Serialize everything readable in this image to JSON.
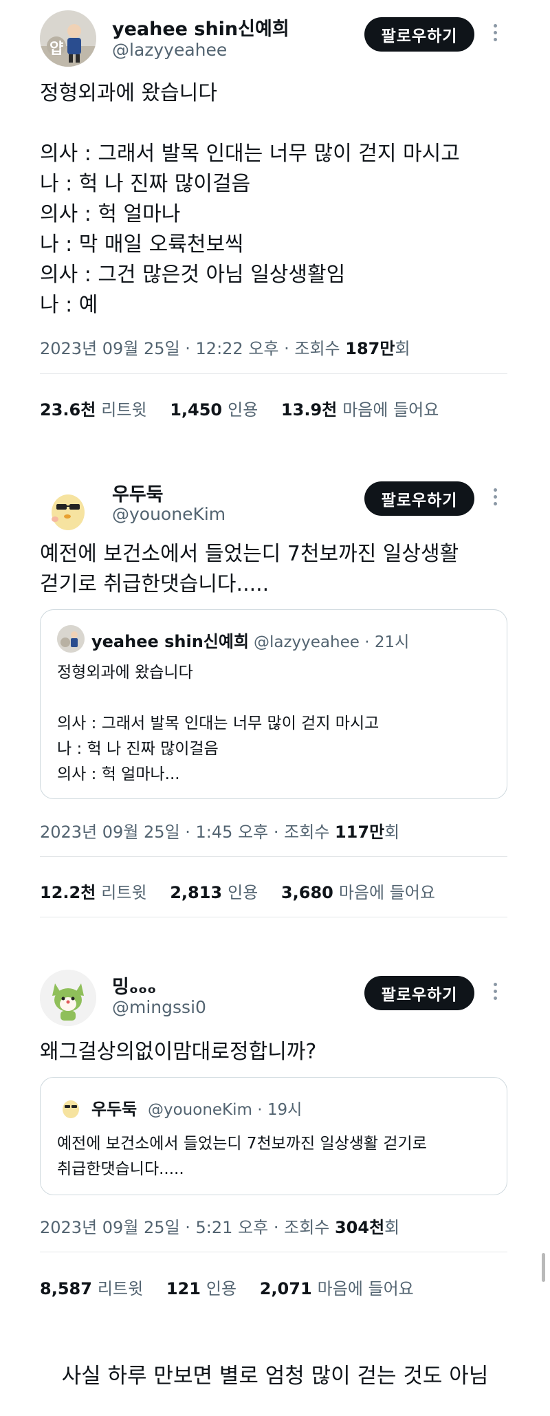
{
  "tweets": [
    {
      "author_name": "yeahee shin신예희",
      "handle": "@lazyyeahee",
      "follow_label": "팔로우하기",
      "avatar_text": "얍",
      "text": "정형외과에 왔습니다\n\n의사 : 그래서 발목 인대는 너무 많이 걷지 마시고\n나 : 헉 나 진짜 많이걸음\n의사 : 헉 얼마나\n나 : 막 매일 오륙천보씩\n의사 : 그건 많은것 아님 일상생활임\n나 : 예",
      "date": "2023년 09월 25일 · 12:22 오후 · 조회수 ",
      "views_number": "187만",
      "views_suffix": "회",
      "retweets": "23.6천",
      "retweets_label": "리트윗",
      "quotes": "1,450",
      "quotes_label": "인용",
      "likes": "13.9천",
      "likes_label": "마음에 들어요"
    },
    {
      "author_name": "우두둑",
      "handle": "@youoneKim",
      "follow_label": "팔로우하기",
      "text": "예전에 보건소에서 들었는디 7천보까진 일상생활\n걷기로 취급한댓습니다.....",
      "quoted": {
        "author_name": "yeahee shin신예희",
        "handle": "@lazyyeahee · 21시",
        "text": "정형외과에 왔습니다\n\n의사 : 그래서 발목 인대는 너무 많이 걷지 마시고\n나 : 헉 나 진짜 많이걸음\n의사 : 헉 얼마나..."
      },
      "date": "2023년 09월 25일 · 1:45 오후 · 조회수 ",
      "views_number": "117만",
      "views_suffix": "회",
      "retweets": "12.2천",
      "retweets_label": "리트윗",
      "quotes": "2,813",
      "quotes_label": "인용",
      "likes": "3,680",
      "likes_label": "마음에 들어요"
    },
    {
      "author_name": "밍ₒₒₒ",
      "handle": "@mingssi0",
      "follow_label": "팔로우하기",
      "text": "왜그걸상의없이맘대로정합니까?",
      "quoted": {
        "author_name": "우두둑",
        "handle": "@youoneKim · 19시",
        "text": "예전에 보건소에서 들었는디 7천보까진 일상생활 걷기로\n취급한댓습니다....."
      },
      "date": "2023년 09월 25일 · 5:21 오후 · 조회수 ",
      "views_number": "304천",
      "views_suffix": "회",
      "retweets": "8,587",
      "retweets_label": "리트윗",
      "quotes": "121",
      "quotes_label": "인용",
      "likes": "2,071",
      "likes_label": "마음에 들어요"
    }
  ],
  "caption": "사실 하루 만보면 별로 엄청 많이 걷는 것도 아님",
  "colors": {
    "text": "#0f1419",
    "secondary": "#536471",
    "button_bg": "#0f1419",
    "divider": "#e3e6e8",
    "quote_border": "#cfd9de"
  }
}
